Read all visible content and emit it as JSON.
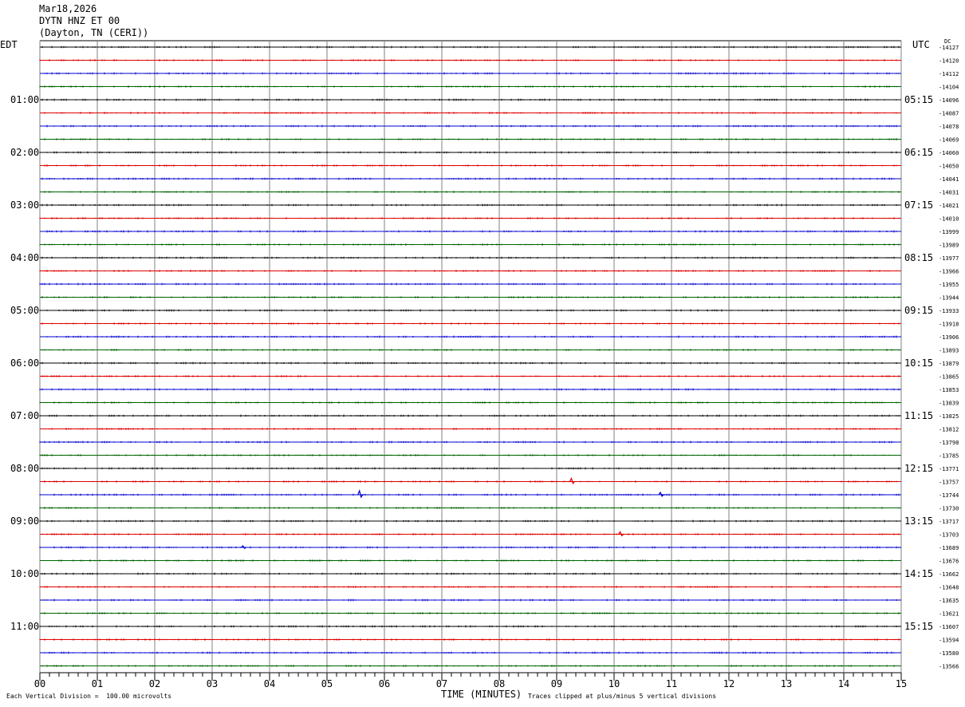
{
  "header": {
    "date": "Mar18,2026",
    "station": "DYTN HNZ ET 00",
    "location": "(Dayton, TN (CERI))"
  },
  "left_tz": "EDT",
  "right_tz": "UTC",
  "dc_label": "DC",
  "footer": {
    "scale_note": "Each Vertical Division =  100.00 microvolts",
    "xlabel": "TIME (MINUTES)",
    "clip_note": "Traces clipped at plus/minus 5 vertical divisions"
  },
  "chart_data": {
    "type": "line",
    "xlabel": "TIME (MINUTES)",
    "xlim": [
      0,
      15
    ],
    "x_ticks": [
      "00",
      "01",
      "02",
      "03",
      "04",
      "05",
      "06",
      "07",
      "08",
      "09",
      "10",
      "11",
      "12",
      "13",
      "14",
      "15"
    ],
    "trace_colors": [
      "#000000",
      "#e00000",
      "#0000d0",
      "#006400"
    ],
    "grid": "vertical lines every minute",
    "left_hour_labels": [
      "01:00",
      "02:00",
      "03:00",
      "04:00",
      "05:00",
      "06:00",
      "07:00",
      "08:00",
      "09:00",
      "10:00",
      "11:00"
    ],
    "right_hour_labels": [
      "05:15",
      "06:15",
      "07:15",
      "08:15",
      "09:15",
      "10:15",
      "11:15",
      "12:15",
      "13:15",
      "14:15",
      "15:15"
    ],
    "dc_offsets": [
      "-14127",
      "-14120",
      "-14112",
      "-14104",
      "-14096",
      "-14087",
      "-14078",
      "-14069",
      "-14060",
      "-14050",
      "-14041",
      "-14031",
      "-14021",
      "-14010",
      "-13999",
      "-13989",
      "-13977",
      "-13966",
      "-13955",
      "-13944",
      "-13933",
      "-13918",
      "-13906",
      "-13893",
      "-13879",
      "-13865",
      "-13853",
      "-13839",
      "-13825",
      "-13812",
      "-13798",
      "-13785",
      "-13771",
      "-13757",
      "-13744",
      "-13730",
      "-13717",
      "-13703",
      "-13689",
      "-13676",
      "-13662",
      "-13648",
      "-13635",
      "-13621",
      "-13607",
      "-13594",
      "-13580",
      "-13566"
    ],
    "events": [
      {
        "trace": 33,
        "minute": 9.27,
        "amplitude": 4
      },
      {
        "trace": 34,
        "minute": 5.58,
        "amplitude": 5
      },
      {
        "trace": 34,
        "minute": 10.82,
        "amplitude": 3
      },
      {
        "trace": 37,
        "minute": 10.12,
        "amplitude": 3
      },
      {
        "trace": 38,
        "minute": 3.55,
        "amplitude": 2
      }
    ]
  }
}
